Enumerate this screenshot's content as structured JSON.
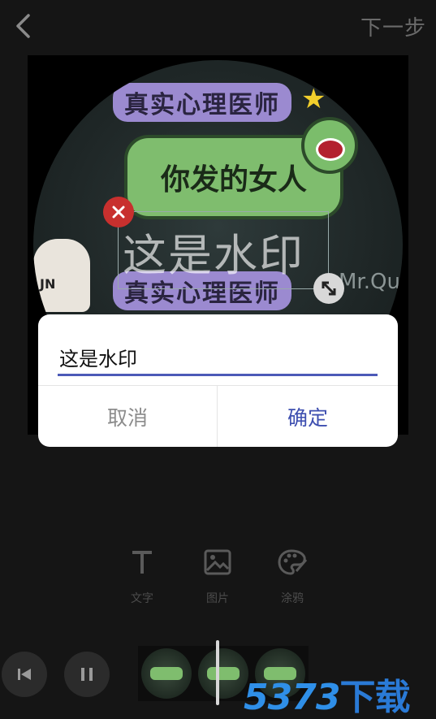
{
  "header": {
    "next_label": "下一步"
  },
  "preview": {
    "sticker_top": "真实心理医师",
    "bubble_text": "你发的女人",
    "sticker_bottom": "真实心理医师",
    "bear_tag": "JN",
    "corner_text": "Mr.Qu",
    "watermark_text": "这是水印"
  },
  "dialog": {
    "input_value": "这是水印",
    "cancel_label": "取消",
    "ok_label": "确定",
    "accent_color": "#3e4fb0"
  },
  "tools": [
    {
      "label": "文字",
      "icon": "text-icon"
    },
    {
      "label": "图片",
      "icon": "image-icon"
    },
    {
      "label": "涂鸦",
      "icon": "palette-icon"
    }
  ],
  "watermark_brand": {
    "number": "5373",
    "suffix": "下载"
  }
}
